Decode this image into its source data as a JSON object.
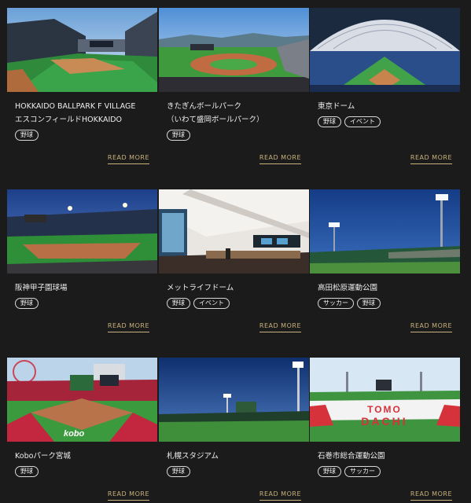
{
  "venues": [
    {
      "title_lines": [
        "HOKKAIDO BALLPARK F VILLAGE",
        "エスコンフィールドHOKKAIDO"
      ],
      "tags": [
        "野球"
      ],
      "read_more": "READ MORE"
    },
    {
      "title_lines": [
        "きたぎんボールパーク",
        "（いわて盛岡ボールパーク）"
      ],
      "tags": [
        "野球"
      ],
      "read_more": "READ MORE"
    },
    {
      "title_lines": [
        "東京ドーム"
      ],
      "tags": [
        "野球",
        "イベント"
      ],
      "read_more": "READ MORE"
    },
    {
      "title_lines": [
        "阪神甲子園球場"
      ],
      "tags": [
        "野球"
      ],
      "read_more": "READ MORE"
    },
    {
      "title_lines": [
        "メットライフドーム"
      ],
      "tags": [
        "野球",
        "イベント"
      ],
      "read_more": "READ MORE"
    },
    {
      "title_lines": [
        "高田松原運動公園"
      ],
      "tags": [
        "サッカー",
        "野球"
      ],
      "read_more": "READ MORE"
    },
    {
      "title_lines": [
        "Koboパーク宮城"
      ],
      "tags": [
        "野球"
      ],
      "read_more": "READ MORE",
      "photo_text": "kobo"
    },
    {
      "title_lines": [
        "札幌スタジアム"
      ],
      "tags": [
        "野球"
      ],
      "read_more": "READ MORE"
    },
    {
      "title_lines": [
        "石巻市総合運動公園"
      ],
      "tags": [
        "野球",
        "サッカー"
      ],
      "read_more": "READ MORE",
      "photo_text": [
        "TOMO",
        "DACHI"
      ]
    }
  ],
  "colors": {
    "background": "#1b1b1b",
    "accent": "#c9b27c",
    "text": "#eeeeee"
  }
}
